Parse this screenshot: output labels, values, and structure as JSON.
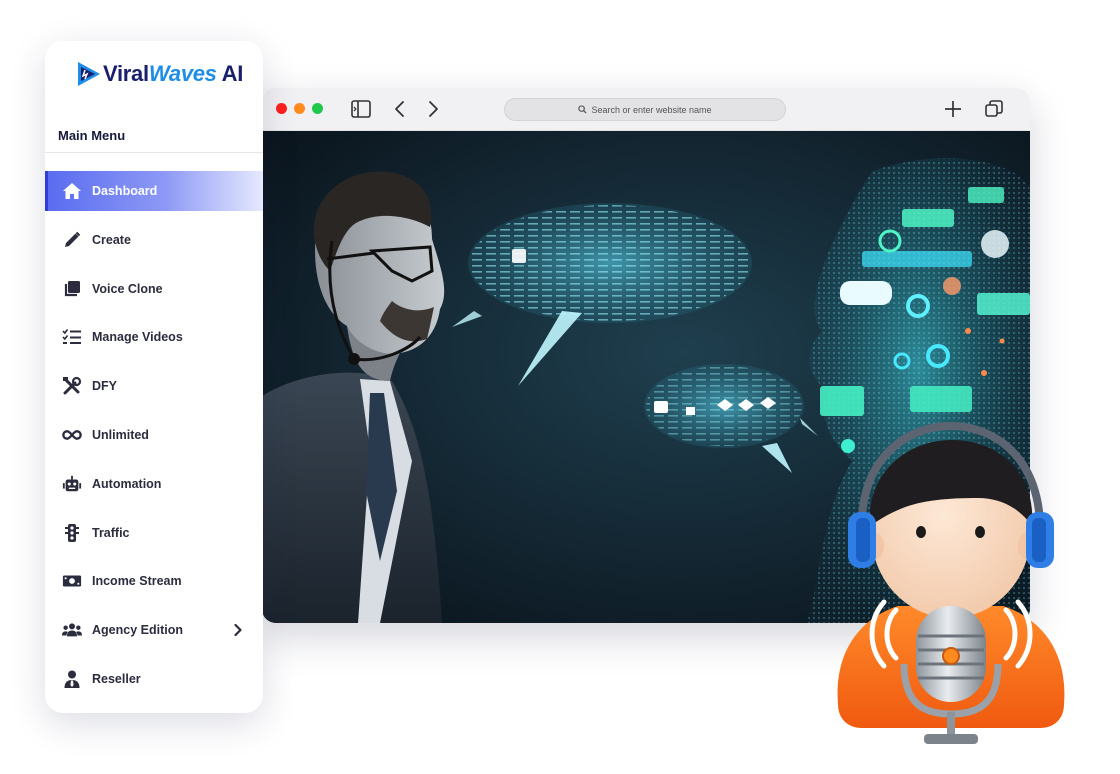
{
  "brand": {
    "name_part1": "Viral",
    "name_part2": "Waves",
    "name_part3": " AI",
    "accent": "#1e8de8",
    "dark": "#1a1f6b"
  },
  "sidebar": {
    "menu_title": "Main Menu",
    "items": [
      {
        "label": "Dashboard",
        "icon": "home-icon",
        "active": true
      },
      {
        "label": "Create",
        "icon": "pencil-icon"
      },
      {
        "label": "Voice Clone",
        "icon": "copy-icon"
      },
      {
        "label": "Manage Videos",
        "icon": "checklist-icon"
      },
      {
        "label": "DFY",
        "icon": "tools-icon"
      },
      {
        "label": "Unlimited",
        "icon": "infinity-icon"
      },
      {
        "label": "Automation",
        "icon": "robot-icon"
      },
      {
        "label": "Traffic",
        "icon": "traffic-light-icon"
      },
      {
        "label": "Income Stream",
        "icon": "money-icon"
      },
      {
        "label": "Agency Edition",
        "icon": "users-icon",
        "has_submenu": true
      },
      {
        "label": "Reseller",
        "icon": "user-tie-icon"
      }
    ]
  },
  "browser": {
    "url_placeholder": "Search or enter website name",
    "traffic_colors": [
      "#ff1f1f",
      "#ff8a1e",
      "#22c84a"
    ]
  }
}
